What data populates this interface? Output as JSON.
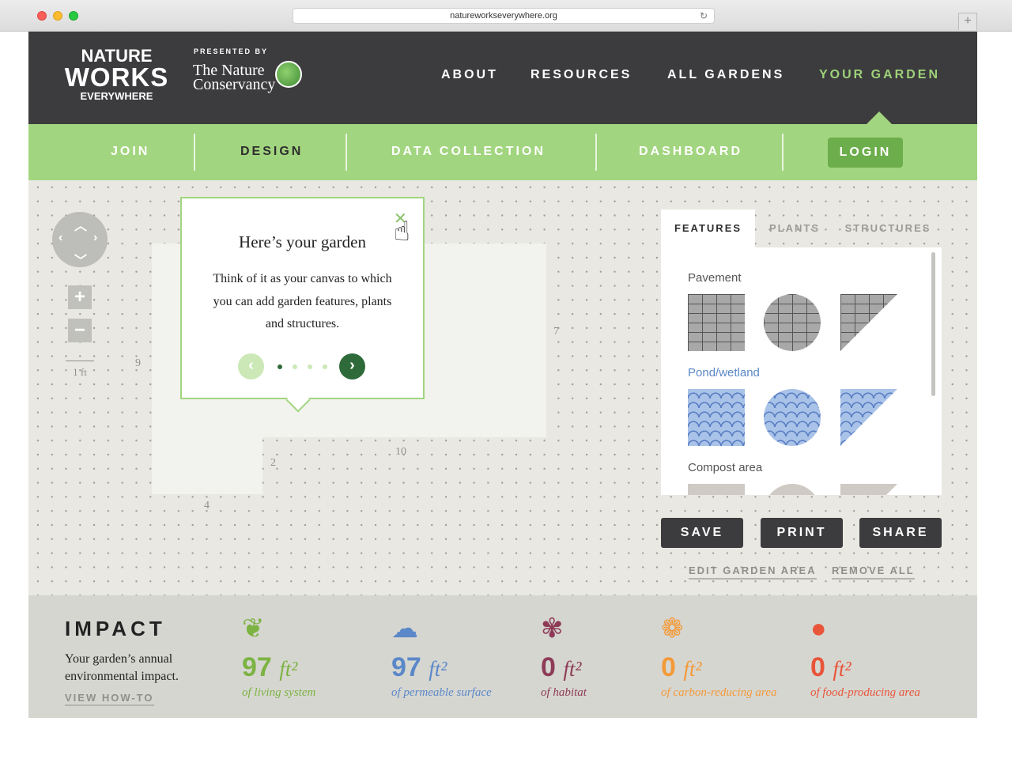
{
  "browser": {
    "url": "natureworkseverywhere.org",
    "new_tab": "+"
  },
  "logo": {
    "line1": "NATURE",
    "line2": "WORKS",
    "line3": "EVERYWHERE"
  },
  "partner": {
    "presented_by": "PRESENTED BY",
    "name_line1": "The Nature",
    "name_line2": "Conservancy"
  },
  "main_nav": [
    {
      "label": "ABOUT"
    },
    {
      "label": "RESOURCES"
    },
    {
      "label": "ALL GARDENS"
    },
    {
      "label": "YOUR GARDEN",
      "active": true
    }
  ],
  "sub_nav": [
    {
      "label": "JOIN"
    },
    {
      "label": "DESIGN",
      "active": true
    },
    {
      "label": "DATA COLLECTION"
    },
    {
      "label": "DASHBOARD"
    },
    {
      "label": "LOGIN"
    }
  ],
  "canvas": {
    "dimensions": [
      "9",
      "7",
      "10",
      "2",
      "4"
    ],
    "scale_label": "1 ft",
    "zoom_in": "+",
    "zoom_out": "−"
  },
  "popup": {
    "title": "Here’s your garden",
    "body": "Think of it as your canvas to which you can add garden features, plants and structures.",
    "prev": "‹",
    "next": "›",
    "close": "✕",
    "page": 1,
    "pages": 4
  },
  "panel": {
    "tabs": [
      {
        "label": "FEATURES",
        "active": true
      },
      {
        "label": "PLANTS"
      },
      {
        "label": "STRUCTURES"
      }
    ],
    "categories": [
      {
        "label": "Pavement"
      },
      {
        "label": "Pond/wetland"
      },
      {
        "label": "Compost area"
      }
    ]
  },
  "actions": {
    "save": "SAVE",
    "print": "PRINT",
    "share": "SHARE",
    "edit_area": "EDIT GARDEN AREA",
    "remove_all": "REMOVE ALL"
  },
  "impact": {
    "title": "IMPACT",
    "description": "Your garden’s annual environmental impact.",
    "howto": "VIEW HOW-TO",
    "metrics": [
      {
        "value": "97",
        "unit": "ft²",
        "label": "of living system",
        "color": "#7cb342"
      },
      {
        "value": "97",
        "unit": "ft²",
        "label": "of permeable surface",
        "color": "#5b88c8"
      },
      {
        "value": "0",
        "unit": "ft²",
        "label": "of habitat",
        "color": "#8e3b57"
      },
      {
        "value": "0",
        "unit": "ft²",
        "label": "of carbon-reducing area",
        "color": "#f39a38"
      },
      {
        "value": "0",
        "unit": "ft²",
        "label": "of food-producing area",
        "color": "#e8553a"
      }
    ]
  },
  "colors": {
    "topbar": "#3c3c3e",
    "subbar": "#a2d57f",
    "accent": "#9ed27a",
    "login": "#6cad4c"
  }
}
